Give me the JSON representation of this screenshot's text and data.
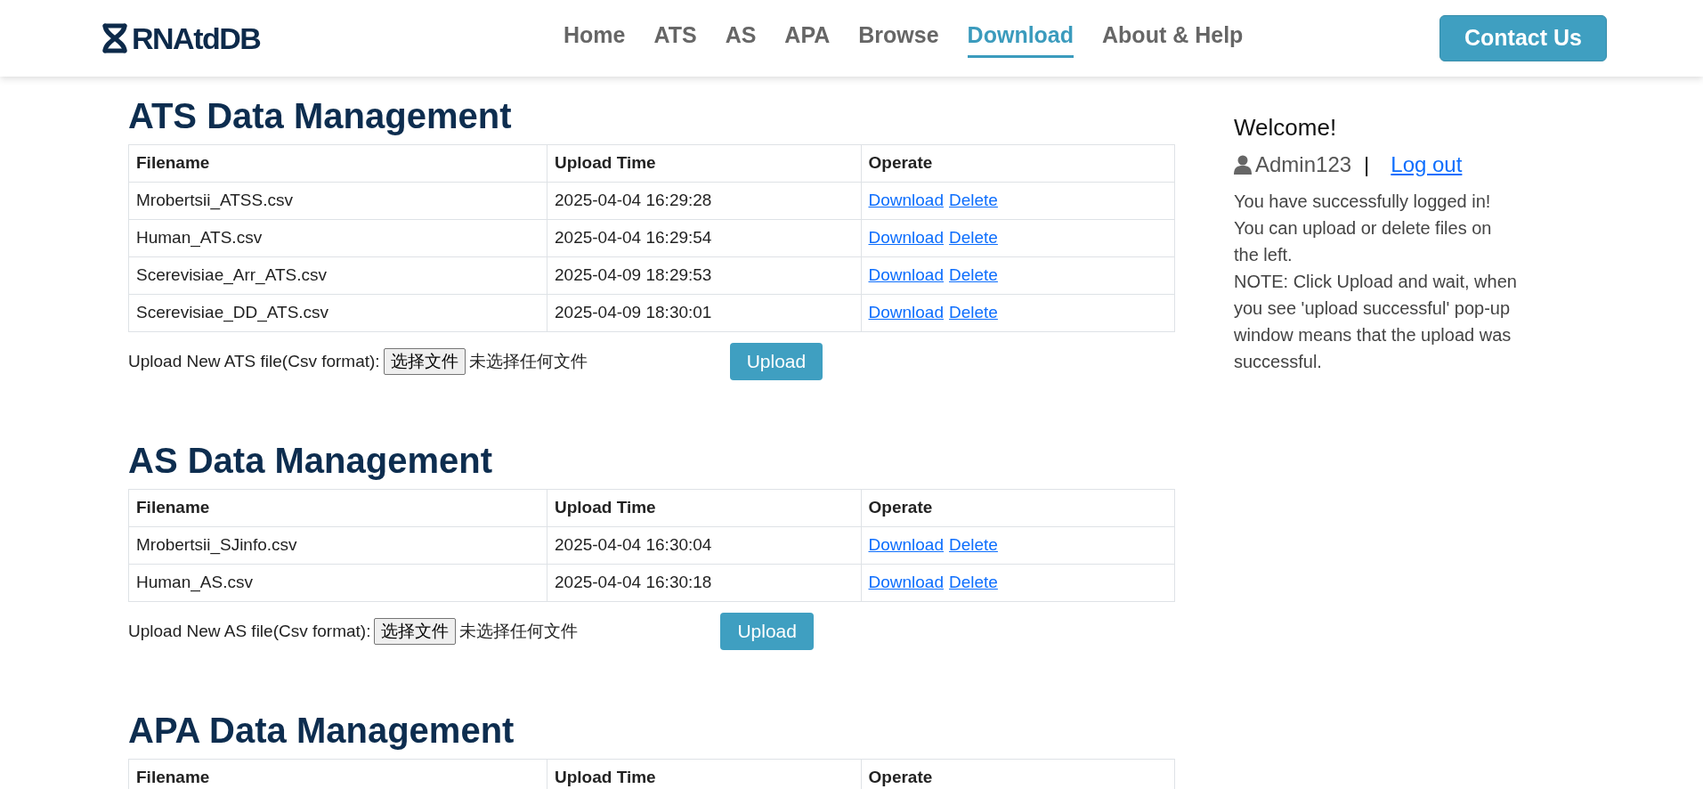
{
  "navbar": {
    "logo": "RNAtdDB",
    "items": [
      {
        "label": "Home",
        "selected": false
      },
      {
        "label": "ATS",
        "selected": false
      },
      {
        "label": "AS",
        "selected": false
      },
      {
        "label": "APA",
        "selected": false
      },
      {
        "label": "Browse",
        "selected": false
      },
      {
        "label": "Download",
        "selected": true
      },
      {
        "label": "About & Help",
        "selected": false
      }
    ],
    "contact_button": "Contact Us"
  },
  "sections": [
    {
      "title": "ATS Data Management",
      "columns": [
        "Filename",
        "Upload Time",
        "Operate"
      ],
      "rows": [
        {
          "filename": "Mrobertsii_ATSS.csv",
          "upload_time": "2025-04-04 16:29:28",
          "actions": [
            "Download",
            "Delete"
          ]
        },
        {
          "filename": "Human_ATS.csv",
          "upload_time": "2025-04-04 16:29:54",
          "actions": [
            "Download",
            "Delete"
          ]
        },
        {
          "filename": "Scerevisiae_Arr_ATS.csv",
          "upload_time": "2025-04-09 18:29:53",
          "actions": [
            "Download",
            "Delete"
          ]
        },
        {
          "filename": "Scerevisiae_DD_ATS.csv",
          "upload_time": "2025-04-09 18:30:01",
          "actions": [
            "Download",
            "Delete"
          ]
        }
      ],
      "upload": {
        "label": "Upload New ATS file(Csv format):",
        "choose_button": "选择文件",
        "no_file_text": "未选择任何文件",
        "button": "Upload"
      }
    },
    {
      "title": "AS Data Management",
      "columns": [
        "Filename",
        "Upload Time",
        "Operate"
      ],
      "rows": [
        {
          "filename": "Mrobertsii_SJinfo.csv",
          "upload_time": "2025-04-04 16:30:04",
          "actions": [
            "Download",
            "Delete"
          ]
        },
        {
          "filename": "Human_AS.csv",
          "upload_time": "2025-04-04 16:30:18",
          "actions": [
            "Download",
            "Delete"
          ]
        }
      ],
      "upload": {
        "label": "Upload New AS file(Csv format):",
        "choose_button": "选择文件",
        "no_file_text": "未选择任何文件",
        "button": "Upload"
      }
    },
    {
      "title": "APA Data Management",
      "columns": [
        "Filename",
        "Upload Time",
        "Operate"
      ]
    }
  ],
  "sidebar": {
    "welcome": "Welcome!",
    "username": "Admin123",
    "separator": "|",
    "logout": "Log out",
    "paragraphs": [
      "You have successfully logged in! You can upload or delete files on the left.",
      "NOTE: Click Upload and wait, when you see 'upload successful' pop-up window means that the upload was successful."
    ]
  }
}
